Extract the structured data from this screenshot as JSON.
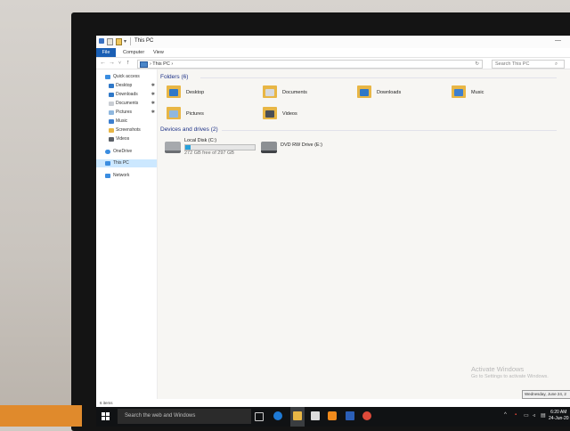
{
  "window": {
    "title": "This PC",
    "controls": "—"
  },
  "ribbon": {
    "tabs": [
      "File",
      "Computer",
      "View"
    ]
  },
  "address": {
    "back": "←",
    "forward": "→",
    "recent": "˅",
    "up": "↑",
    "path": "›  This PC  ›",
    "refresh": "↻",
    "search_placeholder": "Search This PC"
  },
  "navpane": {
    "items": [
      {
        "label": "Quick access",
        "icon": "star-icon",
        "pinned": false
      },
      {
        "label": "Desktop",
        "icon": "desktop-folder-icon",
        "pinned": true
      },
      {
        "label": "Downloads",
        "icon": "downloads-folder-icon",
        "pinned": true
      },
      {
        "label": "Documents",
        "icon": "documents-folder-icon",
        "pinned": true
      },
      {
        "label": "Pictures",
        "icon": "pictures-folder-icon",
        "pinned": true
      },
      {
        "label": "Music",
        "icon": "music-folder-icon",
        "pinned": false
      },
      {
        "label": "Screenshots",
        "icon": "folder-icon",
        "pinned": false
      },
      {
        "label": "Videos",
        "icon": "videos-folder-icon",
        "pinned": false
      },
      {
        "label": "OneDrive",
        "icon": "cloud-icon",
        "pinned": false
      },
      {
        "label": "This PC",
        "icon": "computer-icon",
        "pinned": false
      },
      {
        "label": "Network",
        "icon": "network-icon",
        "pinned": false
      }
    ],
    "pin_glyph": "✱"
  },
  "folders": {
    "heading": "Folders (6)",
    "items": [
      "Desktop",
      "Documents",
      "Downloads",
      "Music",
      "Pictures",
      "Videos"
    ]
  },
  "drives": {
    "heading": "Devices and drives (2)",
    "local": {
      "label": "Local Disk (C:)",
      "free": "272 GB free of 297 GB",
      "used_fraction": 0.08
    },
    "dvd": {
      "label": "DVD RW Drive (E:)"
    }
  },
  "status": {
    "items": "6 items"
  },
  "activation": {
    "title": "Activate Windows",
    "subtitle": "Go to Settings to activate Windows."
  },
  "tooltip": "Wednesday, June 24, 2",
  "taskbar": {
    "search_placeholder": "Search the web and Windows",
    "time": "6:20 AM",
    "date": "24-Jun-20"
  },
  "colors": {
    "accent": "#1a5fb4",
    "folder": "#e8b645",
    "selection": "#cce8ff",
    "drive_bar": "#26a0da"
  }
}
